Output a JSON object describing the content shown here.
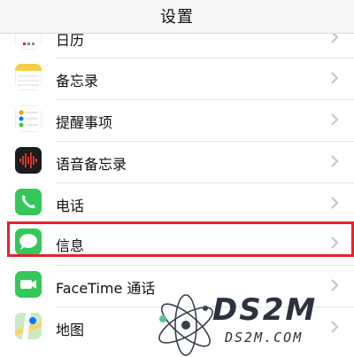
{
  "navbar": {
    "title": "设置"
  },
  "rows": [
    {
      "label": "日历",
      "icon": "calendar-icon"
    },
    {
      "label": "备忘录",
      "icon": "notes-icon"
    },
    {
      "label": "提醒事项",
      "icon": "reminders-icon"
    },
    {
      "label": "语音备忘录",
      "icon": "voice-memos-icon"
    },
    {
      "label": "电话",
      "icon": "phone-icon"
    },
    {
      "label": "信息",
      "icon": "messages-icon",
      "highlighted": true
    },
    {
      "label": "FaceTime 通话",
      "icon": "facetime-icon"
    },
    {
      "label": "地图",
      "icon": "maps-icon"
    }
  ],
  "watermark": {
    "main": "DS2M",
    "sub": "DS2M.COM"
  },
  "colors": {
    "highlight": "#e5232b",
    "green": "#34c759",
    "separator": "#e3e3e6"
  }
}
